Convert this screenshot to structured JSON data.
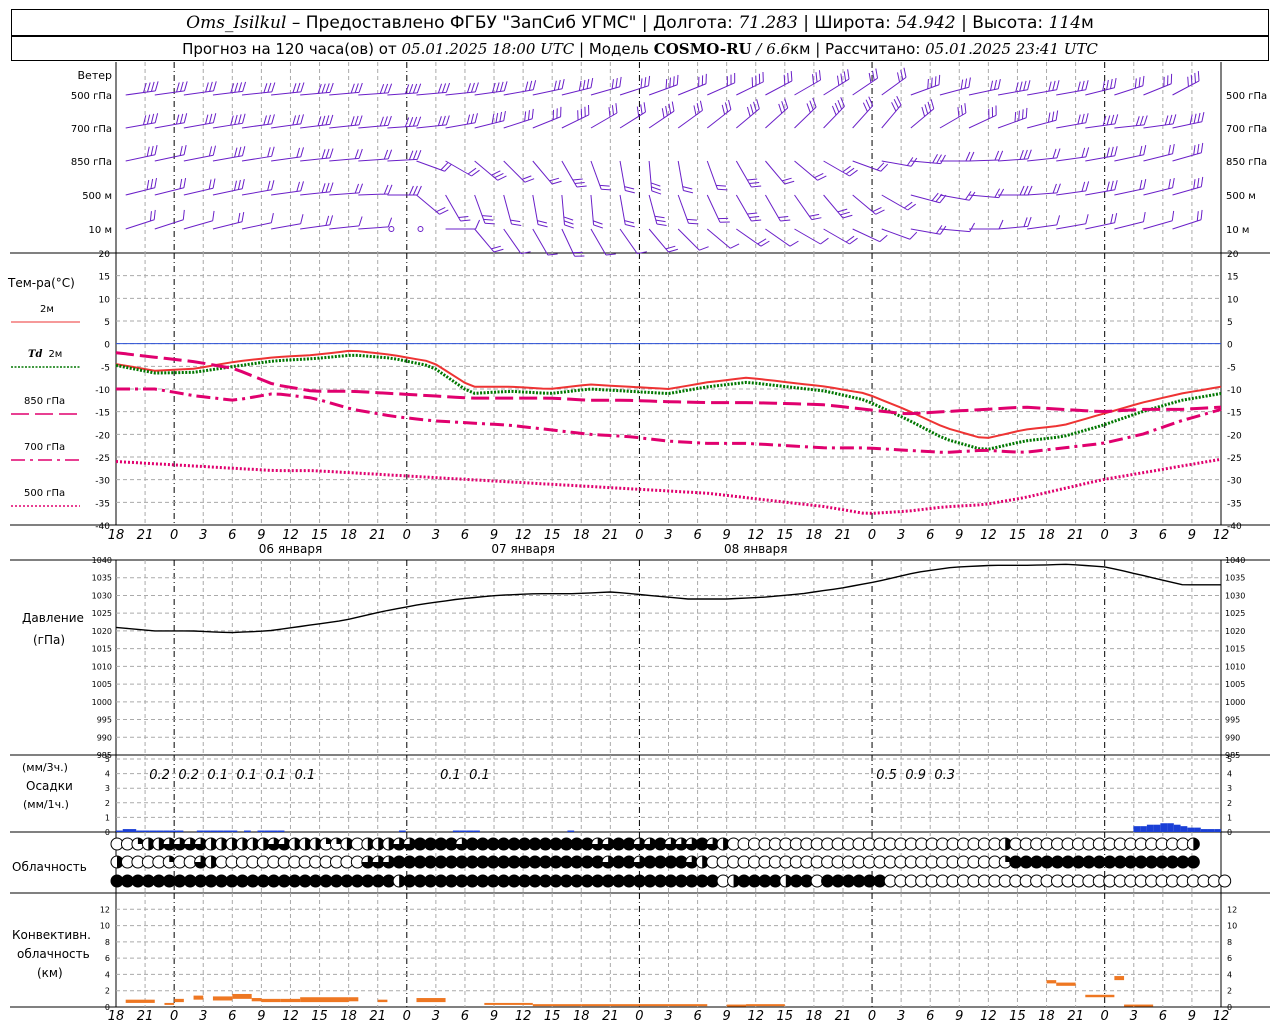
{
  "header": {
    "station": "Oms_Isilkul",
    "dash": " – ",
    "provider": "Предоставлено ФГБУ \"ЗапСиб УГМС\"",
    "sep": " | ",
    "lon_label": "Долгота: ",
    "lon": "71.283",
    "lat_label": "Широта: ",
    "lat": "54.942",
    "alt_label": "Высота: ",
    "alt": "114",
    "alt_unit": "м"
  },
  "subheader": {
    "forecast_label": "Прогноз на 120 часа(ов) от ",
    "from_time": "05.01.2025 18:00 UTC",
    "model_label": "  | Модель ",
    "model": "COSMO-RU",
    "resolution": " / 6.6",
    "res_unit": "км",
    "calc_label": " | Рассчитано: ",
    "calc_time": "05.01.2025 23:41 UTC"
  },
  "colors": {
    "t2m": "#ee3333",
    "td2m": "#007700",
    "t850": "#e0006e",
    "t700": "#e0006e",
    "t500": "#e0006e",
    "wind": "#6a1fc8",
    "pressure": "#000000",
    "precip": "#1a3fd6",
    "convective": "#ee7722",
    "zero_line": "#2a4fd6"
  },
  "chart_data": [
    {
      "type": "wind_barbs",
      "title": "Ветер",
      "levels": [
        "500 гПа",
        "700 гПа",
        "850 гПа",
        "500 м",
        "10 м"
      ],
      "x_hours": [
        18,
        21,
        0,
        3,
        6,
        9,
        12,
        15,
        18,
        21,
        0,
        3,
        6,
        9,
        12,
        15,
        18,
        21,
        0,
        3,
        6,
        9,
        12,
        15,
        18,
        21,
        0,
        3,
        6,
        9,
        12,
        15,
        18,
        21,
        0,
        3,
        6,
        9,
        12,
        15,
        18,
        21,
        0
      ]
    },
    {
      "type": "line",
      "ylabel": "Тем-ра(°C)",
      "ylim": [
        -40,
        20
      ],
      "yticks": [
        20,
        15,
        10,
        5,
        0,
        -5,
        -10,
        -15,
        -20,
        -25,
        -30,
        -35,
        -40
      ],
      "x_ticks": [
        "18",
        "21",
        "0",
        "3",
        "6",
        "9",
        "12",
        "15",
        "18",
        "21",
        "0",
        "3",
        "6",
        "9",
        "12",
        "15",
        "18",
        "21",
        "0",
        "3",
        "6",
        "9",
        "12",
        "15",
        "18",
        "21",
        "0"
      ],
      "day_labels": [
        "06 января",
        "07 января",
        "08 января"
      ],
      "x_hours": [
        0,
        6,
        12,
        18,
        24,
        30,
        36,
        42,
        48,
        54,
        60,
        66,
        72,
        78,
        84,
        90,
        96,
        102,
        108,
        114,
        120,
        126,
        132,
        138,
        144,
        150,
        156
      ],
      "series": [
        {
          "name": "2м",
          "style": "solid",
          "values": [
            -4.5,
            -6.0,
            -5.5,
            -4.0,
            -3.0,
            -2.5,
            -1.5,
            -2.5,
            -4.0,
            -9.5,
            -9.5,
            -10.0,
            -9.0,
            -9.5,
            -10.0,
            -8.5,
            -7.5,
            -8.5,
            -9.5,
            -11.0,
            -14.5,
            -18.5,
            -21.0,
            -19.0,
            -18.0,
            -15.5,
            -13.0,
            -11.0,
            -9.5
          ]
        },
        {
          "name": "Td 2м",
          "style": "dotted",
          "values": [
            -4.8,
            -6.5,
            -6.3,
            -5.0,
            -3.8,
            -3.3,
            -2.5,
            -3.2,
            -5.0,
            -11.0,
            -10.5,
            -11.0,
            -10.0,
            -10.5,
            -11.0,
            -9.5,
            -8.5,
            -9.5,
            -10.5,
            -12.5,
            -16.5,
            -21.0,
            -23.5,
            -21.5,
            -20.5,
            -18.0,
            -15.0,
            -12.5,
            -11.0
          ]
        },
        {
          "name": "850 гПа",
          "style": "dashed",
          "values": [
            -2.0,
            -3.0,
            -4.0,
            -5.5,
            -9.0,
            -10.5,
            -10.5,
            -11.0,
            -11.5,
            -12.0,
            -12.0,
            -12.0,
            -12.5,
            -12.5,
            -12.8,
            -13.0,
            -13.0,
            -13.2,
            -13.5,
            -14.5,
            -15.5,
            -15.0,
            -14.5,
            -14.0,
            -14.5,
            -15.0,
            -14.5,
            -14.5,
            -14.0
          ]
        },
        {
          "name": "700 гПа",
          "style": "dashdot",
          "values": [
            -10.0,
            -10.0,
            -11.5,
            -12.5,
            -11.0,
            -12.0,
            -14.5,
            -16.0,
            -17.0,
            -17.5,
            -18.0,
            -19.0,
            -20.0,
            -20.5,
            -21.5,
            -22.0,
            -22.0,
            -22.5,
            -23.0,
            -23.0,
            -23.5,
            -24.0,
            -23.5,
            -24.0,
            -23.0,
            -22.0,
            -20.0,
            -17.0,
            -14.5
          ]
        },
        {
          "name": "500 гПа",
          "style": "fine-dotted",
          "values": [
            -26.0,
            -26.5,
            -27.0,
            -27.5,
            -28.0,
            -28.0,
            -28.5,
            -29.0,
            -29.5,
            -30.0,
            -30.5,
            -31.0,
            -31.5,
            -32.0,
            -32.5,
            -33.0,
            -34.0,
            -35.0,
            -36.0,
            -37.5,
            -37.0,
            -36.0,
            -35.5,
            -34.0,
            -32.0,
            -30.0,
            -28.5,
            -27.0,
            -25.5
          ]
        }
      ]
    },
    {
      "type": "line",
      "ylabel": "Давление",
      "yunit": "(гПа)",
      "ylim": [
        985,
        1040
      ],
      "yticks": [
        1040,
        1035,
        1030,
        1025,
        1020,
        1015,
        1010,
        1005,
        1000,
        995,
        990,
        985
      ],
      "series": [
        {
          "name": "Давление",
          "values": [
            1021.0,
            1020.0,
            1020.0,
            1019.5,
            1020.0,
            1021.5,
            1023.0,
            1025.5,
            1027.5,
            1029.0,
            1030.0,
            1030.5,
            1030.5,
            1031.0,
            1030.0,
            1029.0,
            1029.0,
            1029.5,
            1030.5,
            1032.0,
            1034.0,
            1036.5,
            1038.0,
            1038.5,
            1038.5,
            1038.8,
            1038.0,
            1035.5,
            1033.0,
            1033.0
          ]
        }
      ]
    },
    {
      "type": "bar",
      "ylabel": "Осадки",
      "yunit_top": "(мм/3ч.)",
      "yunit_bottom": "(мм/1ч.)",
      "ylim": [
        0,
        5
      ],
      "yticks": [
        5,
        4,
        3,
        2,
        1,
        0
      ],
      "labels_3h": [
        "0.2",
        "0.2",
        "0.1",
        "0.1",
        "0.1",
        "0.1",
        "",
        "",
        "",
        "",
        "0.1",
        "0.1",
        "",
        "",
        "",
        "",
        "",
        "",
        "",
        "",
        "",
        "",
        "",
        "",
        "",
        "0.5",
        "0.9",
        "0.3"
      ],
      "hourly_values": [
        0.1,
        0.2,
        0.2,
        0.1,
        0.1,
        0.1,
        0.1,
        0.1,
        0.1,
        0.1,
        0.0,
        0.0,
        0.1,
        0.1,
        0.1,
        0.1,
        0.1,
        0.1,
        0.0,
        0.1,
        0.0,
        0.1,
        0.1,
        0.1,
        0.1,
        0.0,
        0.0,
        0.0,
        0.0,
        0.0,
        0.0,
        0.0,
        0.0,
        0.0,
        0.0,
        0.0,
        0.0,
        0.0,
        0.0,
        0.0,
        0.0,
        0.0,
        0.1,
        0.0,
        0.0,
        0.0,
        0.0,
        0.0,
        0.0,
        0.0,
        0.1,
        0.1,
        0.1,
        0.1,
        0.0,
        0.0,
        0.0,
        0.0,
        0.0,
        0.0,
        0.0,
        0.0,
        0.0,
        0.0,
        0.0,
        0.0,
        0.0,
        0.1,
        0.0,
        0.0,
        0.0,
        0.0,
        0.0,
        0.0,
        0.0,
        0.0,
        0.0,
        0.0,
        0.0,
        0.0,
        0.0,
        0.0,
        0.0,
        0.0,
        0.0,
        0.0,
        0.0,
        0.0,
        0.0,
        0.0,
        0.0,
        0.0,
        0.0,
        0.0,
        0.0,
        0.0,
        0.0,
        0.0,
        0.0,
        0.0,
        0.0,
        0.0,
        0.0,
        0.0,
        0.0,
        0.0,
        0.0,
        0.0,
        0.0,
        0.0,
        0.0,
        0.0,
        0.0,
        0.0,
        0.0,
        0.0,
        0.0,
        0.0,
        0.0,
        0.0,
        0.0,
        0.0,
        0.0,
        0.0,
        0.0,
        0.0,
        0.0,
        0.0,
        0.0,
        0.0,
        0.0,
        0.0,
        0.0,
        0.0,
        0.0,
        0.0,
        0.0,
        0.0,
        0.0,
        0.0,
        0.0,
        0.0,
        0.0,
        0.0,
        0.0,
        0.0,
        0.0,
        0.0,
        0.0,
        0.0,
        0.0,
        0.4,
        0.4,
        0.5,
        0.5,
        0.6,
        0.6,
        0.5,
        0.4,
        0.3,
        0.3,
        0.2,
        0.2,
        0.2
      ]
    },
    {
      "type": "cloud_cover",
      "ylabel": "Облачность",
      "rows": [
        [
          0,
          0,
          0.25,
          0.5,
          0.5,
          0.75,
          0.75,
          0.75,
          0.75,
          0.5,
          0.5,
          0.5,
          0.5,
          0.5,
          0.5,
          0.75,
          0.75,
          0.5,
          0.5,
          0.5,
          0.25,
          0.25,
          0.5,
          0,
          0.5,
          0.5,
          0.5,
          0.75,
          0.75,
          1,
          1,
          1,
          1,
          0.75,
          1,
          1,
          1,
          1,
          1,
          1,
          1,
          1,
          1,
          1,
          1,
          1,
          0.75,
          0.75,
          1,
          1,
          0.75,
          0.75,
          1,
          0.75,
          0.75,
          0.75,
          1,
          0.75,
          0.5,
          0,
          0,
          0,
          0,
          0,
          0,
          0,
          0,
          0,
          0,
          0,
          0,
          0,
          0,
          0,
          0,
          0,
          0,
          0,
          0,
          0,
          0,
          0,
          0,
          0,
          0,
          0.5,
          0,
          0,
          0,
          0,
          0,
          0,
          0,
          0,
          0,
          0,
          0,
          0,
          0,
          0,
          0,
          0,
          0,
          0.5
        ],
        [
          0.5,
          0,
          0,
          0,
          0,
          0.25,
          0,
          0,
          0.75,
          0.5,
          0,
          0,
          0,
          0,
          0,
          0,
          0,
          0,
          0,
          0,
          0,
          0,
          0,
          0,
          0.75,
          0.75,
          0.75,
          1,
          1,
          1,
          1,
          1,
          1,
          1,
          1,
          1,
          1,
          1,
          1,
          1,
          1,
          1,
          1,
          1,
          1,
          1,
          1,
          0.75,
          1,
          1,
          0.75,
          1,
          1,
          1,
          1,
          0.75,
          0.5,
          0,
          0,
          0,
          0,
          0,
          0,
          0,
          0,
          0,
          0,
          0,
          0,
          0,
          0,
          0,
          0,
          0,
          0,
          0,
          0,
          0,
          0,
          0,
          0,
          0,
          0,
          0,
          0,
          0.25,
          1,
          1,
          1,
          1,
          1,
          1,
          1,
          1,
          1,
          1,
          1,
          1,
          1,
          1,
          1,
          1,
          1,
          1
        ],
        [
          1,
          1,
          1,
          1,
          1,
          1,
          1,
          1,
          1,
          1,
          1,
          1,
          1,
          1,
          1,
          1,
          1,
          1,
          1,
          1,
          1,
          1,
          1,
          1,
          1,
          1,
          1,
          0.5,
          1,
          1,
          1,
          1,
          1,
          1,
          1,
          1,
          1,
          1,
          1,
          1,
          1,
          1,
          1,
          1,
          1,
          1,
          1,
          1,
          1,
          1,
          1,
          1,
          1,
          1,
          1,
          1,
          1,
          1,
          0,
          0.5,
          1,
          1,
          1,
          1,
          0.5,
          1,
          1,
          0,
          1,
          1,
          1,
          1,
          1,
          1,
          0,
          0,
          0,
          0,
          0,
          0,
          0,
          0,
          0,
          0,
          0,
          0,
          0,
          0,
          0,
          0,
          0,
          0,
          0,
          0,
          0,
          0,
          0,
          0,
          0,
          0,
          0,
          0,
          0,
          0,
          0,
          0,
          0,
          1,
          1,
          1,
          1
        ]
      ]
    },
    {
      "type": "bar",
      "ylabel": "Конвективн.",
      "ylabel2": "облачность",
      "yunit": "(км)",
      "ylim": [
        0,
        14
      ],
      "yticks": [
        12,
        10,
        8,
        6,
        4,
        2,
        0
      ],
      "segments": [
        {
          "x0": 1,
          "x1": 4,
          "base": 0.5,
          "top": 0.9
        },
        {
          "x0": 5,
          "x1": 6,
          "base": 0.3,
          "top": 0.5
        },
        {
          "x0": 6,
          "x1": 7,
          "base": 0.6,
          "top": 1.0
        },
        {
          "x0": 8,
          "x1": 9,
          "base": 0.9,
          "top": 1.4
        },
        {
          "x0": 10,
          "x1": 12,
          "base": 0.8,
          "top": 1.3
        },
        {
          "x0": 12,
          "x1": 14,
          "base": 1.0,
          "top": 1.6
        },
        {
          "x0": 14,
          "x1": 15,
          "base": 0.7,
          "top": 1.1
        },
        {
          "x0": 15,
          "x1": 17,
          "base": 0.6,
          "top": 1.0
        },
        {
          "x0": 17,
          "x1": 19,
          "base": 0.6,
          "top": 1.0
        },
        {
          "x0": 19,
          "x1": 24,
          "base": 0.6,
          "top": 1.2
        },
        {
          "x0": 24,
          "x1": 25,
          "base": 0.7,
          "top": 1.2
        },
        {
          "x0": 27,
          "x1": 28,
          "base": 0.6,
          "top": 0.9
        },
        {
          "x0": 31,
          "x1": 34,
          "base": 0.6,
          "top": 1.1
        },
        {
          "x0": 38,
          "x1": 43,
          "base": 0.3,
          "top": 0.5
        },
        {
          "x0": 43,
          "x1": 48,
          "base": 0.2,
          "top": 0.35
        },
        {
          "x0": 48,
          "x1": 61,
          "base": 0.2,
          "top": 0.35
        },
        {
          "x0": 63,
          "x1": 65,
          "base": 0.2,
          "top": 0.3
        },
        {
          "x0": 65,
          "x1": 69,
          "base": 0.2,
          "top": 0.35
        },
        {
          "x0": 96,
          "x1": 97,
          "base": 2.9,
          "top": 3.3
        },
        {
          "x0": 97,
          "x1": 99,
          "base": 2.6,
          "top": 3.0
        },
        {
          "x0": 100,
          "x1": 103,
          "base": 1.2,
          "top": 1.5
        },
        {
          "x0": 103,
          "x1": 104,
          "base": 3.3,
          "top": 3.8
        },
        {
          "x0": 104,
          "x1": 107,
          "base": 0.2,
          "top": 0.3
        }
      ]
    }
  ]
}
